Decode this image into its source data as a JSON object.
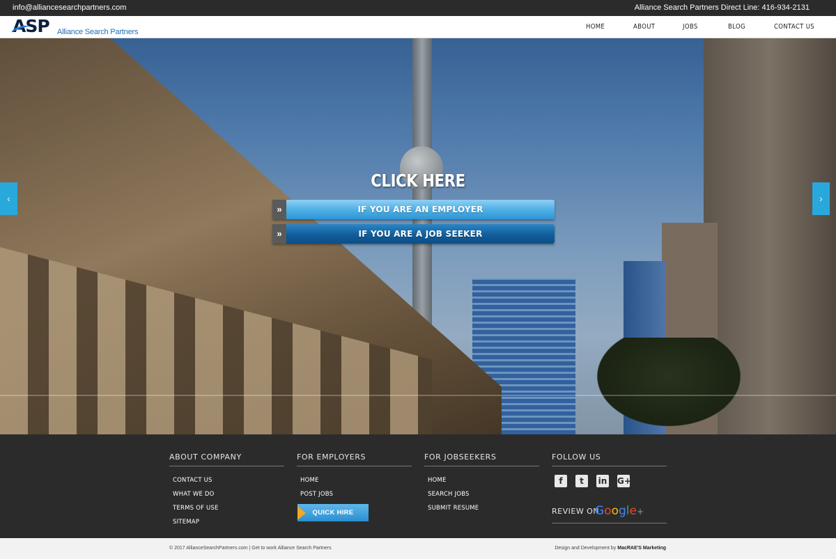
{
  "topbar": {
    "email": "info@alliancesearchpartners.com",
    "phone": "Alliance Search Partners Direct Line: 416-934-2131"
  },
  "header": {
    "logo_mark": "ASP",
    "logo_name": "Alliance Search Partners",
    "nav": [
      "HOME",
      "ABOUT",
      "JOBS",
      "BLOG",
      "CONTACT US"
    ]
  },
  "hero": {
    "title": "CLICK HERE",
    "employer_label": "IF YOU ARE AN EMPLOYER",
    "seeker_label": "IF YOU ARE A JOB SEEKER",
    "prev_icon": "‹",
    "next_icon": "›",
    "chevron_icon": "»"
  },
  "footer": {
    "about": {
      "title": "ABOUT COMPANY",
      "items": [
        "CONTACT US",
        "WHAT WE DO",
        "TERMS OF USE",
        "SITEMAP"
      ]
    },
    "employers": {
      "title": "FOR EMPLOYERS",
      "items": [
        "HOME",
        "POST JOBS"
      ],
      "quick_hire": "QUICK HIRE"
    },
    "jobseekers": {
      "title": "FOR JOBSEEKERS",
      "items": [
        "HOME",
        "SEARCH JOBS",
        "SUBMIT RESUME"
      ]
    },
    "follow": {
      "title": "FOLLOW US",
      "icons": [
        "facebook-icon",
        "twitter-icon",
        "linkedin-icon",
        "google-plus-icon"
      ],
      "review_label": "REVIEW ON",
      "google_text": "Google",
      "google_plus": "+"
    }
  },
  "bottom": {
    "copyright": "© 2017 AllianceSearchPartners.com | Get to work Alliance Search Partners",
    "credit_prefix": "Design and Development by ",
    "credit_name": "MacRAE'S Marketing"
  },
  "colors": {
    "accent_blue": "#29a8dc",
    "dark_bg": "#2b2b2b",
    "quick_hire_arrow": "#f3a91d"
  }
}
